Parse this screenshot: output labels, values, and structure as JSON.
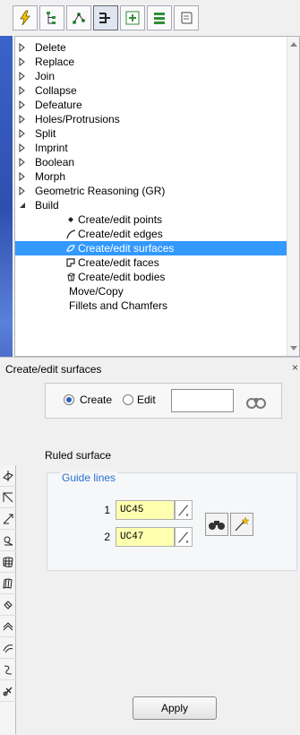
{
  "toolbar": {
    "buttons": [
      {
        "icon": "lightning-icon",
        "active": false
      },
      {
        "icon": "hierarchy-icon",
        "active": false
      },
      {
        "icon": "network-icon",
        "active": false
      },
      {
        "icon": "branch-tree-icon",
        "active": true
      },
      {
        "icon": "grid-plus-icon",
        "active": false
      },
      {
        "icon": "layers-icon",
        "active": false
      },
      {
        "icon": "scroll-icon",
        "active": false
      }
    ]
  },
  "tree": {
    "items": [
      {
        "label": "Delete",
        "expanded": false
      },
      {
        "label": "Replace",
        "expanded": false
      },
      {
        "label": "Join",
        "expanded": false
      },
      {
        "label": "Collapse",
        "expanded": false
      },
      {
        "label": "Defeature",
        "expanded": false
      },
      {
        "label": "Holes/Protrusions",
        "expanded": false
      },
      {
        "label": "Split",
        "expanded": false
      },
      {
        "label": "Imprint",
        "expanded": false
      },
      {
        "label": "Boolean",
        "expanded": false
      },
      {
        "label": "Morph",
        "expanded": false
      },
      {
        "label": "Geometric Reasoning (GR)",
        "expanded": false
      },
      {
        "label": "Build",
        "expanded": true
      }
    ],
    "build_children": [
      {
        "label": "Create/edit points",
        "icon": "point-icon"
      },
      {
        "label": "Create/edit edges",
        "icon": "edge-icon"
      },
      {
        "label": "Create/edit surfaces",
        "icon": "surface-icon",
        "selected": true
      },
      {
        "label": "Create/edit faces",
        "icon": "face-icon"
      },
      {
        "label": "Create/edit bodies",
        "icon": "body-icon"
      },
      {
        "label": "Move/Copy",
        "icon": ""
      },
      {
        "label": "Fillets and Chamfers",
        "icon": ""
      }
    ]
  },
  "panel": {
    "title": "Create/edit surfaces",
    "close": "×",
    "mode": {
      "create_label": "Create",
      "edit_label": "Edit",
      "selected": "create",
      "search_value": ""
    },
    "surface_type": "Ruled surface",
    "guide": {
      "title": "Guide lines",
      "rows": [
        {
          "index": "1",
          "value": "UC45"
        },
        {
          "index": "2",
          "value": "UC47"
        }
      ]
    },
    "apply_label": "Apply"
  },
  "tools": [
    "surface-plane-icon",
    "surface-corner-icon",
    "surface-vector-icon",
    "surface-axis-icon",
    "surface-grid-icon",
    "surface-ruled-icon",
    "surface-rotate-icon",
    "surface-sweep-icon",
    "surface-offset-icon",
    "surface-curve-icon",
    "surface-link-icon"
  ]
}
